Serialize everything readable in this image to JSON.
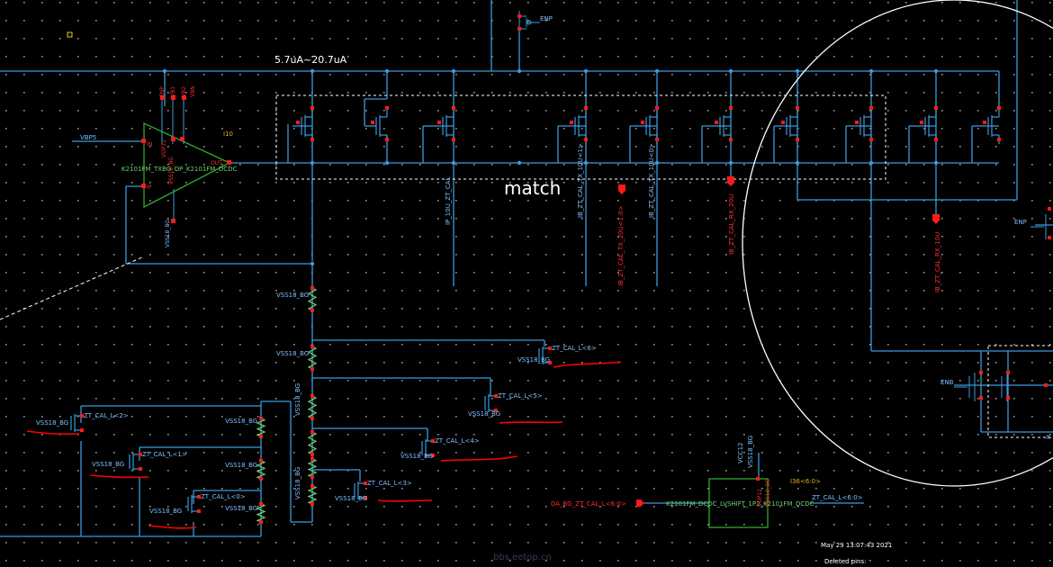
{
  "colors": {
    "background": "#000000",
    "wire": "#3a9bdc",
    "pin": "#ff1a1a",
    "pin_label": "#ff3030",
    "net_label": "#7ec0ff",
    "device": "#6fd26f",
    "opamp_outline": "#2faa2a",
    "annotation": "#ffffff",
    "highlight_box": "#ffffff",
    "redline": "#ff0000",
    "instance_id": "#e0b020",
    "grid_dot": "#9a9a9a"
  },
  "top_annotation": "5.7uA~20.7uA",
  "match_label": "match",
  "opamp": {
    "pin_in_minus": "IN",
    "pin_in_plus": "IP",
    "pin_out": "OUT",
    "instance": "I10",
    "cell": "K2101FM_TXBG_OP_K2101FM_DCDC",
    "supply_pins": [
      "VDP12",
      "VSS18_BG"
    ],
    "bias_pins": [
      "ENP",
      "VB1",
      "VB2",
      "VBN"
    ],
    "ground_label": "VSS18_BG",
    "input_net": "VBP5"
  },
  "nets": {
    "ip_zt_cal": "IP_10U_ZT_CAL",
    "ib_tx_2": "IB_ZT_CAL_TX_10U<1>",
    "ib_tx_1": "IB_ZT_CAL_TX_10U<0>",
    "ib_rx": "IB_ZT_CAL_RX_20U",
    "ib_tx_20u": "IB_ZT_CAL_TX_20U<1:0>",
    "ib_rx_20u": "IB_ZT_CAL_RX_10U",
    "enp_top": "ENP",
    "enp_right": "ENP",
    "enb": "ENB",
    "vdd": "VCC12"
  },
  "ladder_left": [
    "VSS18_BG",
    "VSS18_BG",
    "VSS18_BG"
  ],
  "res_chain_labels": [
    "VSS18_BG",
    "VSS18_BG",
    "VSS18_BG"
  ],
  "switches": [
    {
      "gate": "ZT_CAL_L<6>",
      "sub": "VSS18_BG"
    },
    {
      "gate": "ZT_CAL_L<5>",
      "sub": "VSS18_BG"
    },
    {
      "gate": "ZT_CAL_L<4>",
      "sub": "VSS18_BG"
    },
    {
      "gate": "ZT_CAL_L<3>",
      "sub": "VSS18_BG"
    },
    {
      "gate": "ZT_CAL_L<2>",
      "sub": "VSS18_BG"
    },
    {
      "gate": "ZT_CAL_L<1>",
      "sub": "VSS18_BG"
    },
    {
      "gate": "ZT_CAL_L<0>",
      "sub": "VSS18_BG"
    }
  ],
  "level_shifter": {
    "instance": "I36<6:0>",
    "cell": "K2101FM_DCDC_LVSHIFT_1P2_K2101FM_DCDC",
    "input": "DA_BG_ZT_CAL_L<6:0>",
    "output": "ZT_CAL_L<6:0>",
    "supply": "VCC12",
    "gnd": "VSS18_BG",
    "pins": [
      "VDP12",
      "VSS18_BG"
    ]
  },
  "right_cut_label": "X",
  "status": {
    "timestamp": "May 29 13:07:43 2021",
    "deleted_pins": "Deleted pins:"
  },
  "watermark": "bbs.eetop.cn"
}
